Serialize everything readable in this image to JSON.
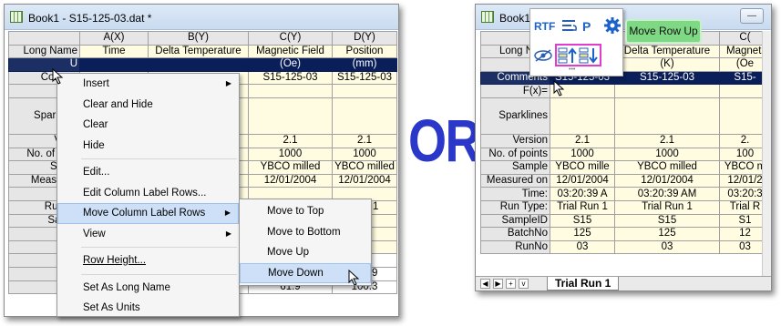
{
  "left": {
    "title": "Book1 - S15-125-03.dat *",
    "columns": [
      "",
      "A(X)",
      "B(Y)",
      "C(Y)",
      "D(Y)"
    ],
    "rows": [
      {
        "label": "Long Name",
        "cells": [
          "Time",
          "Delta Temperature",
          "Magnetic Field",
          "Position"
        ]
      },
      {
        "label": "U",
        "cells": [
          "",
          "",
          "(Oe)",
          "(mm)"
        ],
        "selected": true
      },
      {
        "label": "Comme",
        "cells": [
          "",
          "",
          "S15-125-03",
          "S15-125-03"
        ]
      },
      {
        "label": "F",
        "cells": [
          "",
          "",
          "",
          ""
        ]
      },
      {
        "label": "Sparkline",
        "cells": [
          "",
          "",
          "",
          ""
        ],
        "tall": true
      },
      {
        "label": "Versi",
        "cells": [
          "",
          "",
          "2.1",
          "2.1"
        ]
      },
      {
        "label": "No. of poin",
        "cells": [
          "",
          "",
          "1000",
          "1000"
        ]
      },
      {
        "label": "Samp",
        "cells": [
          "",
          "",
          "YBCO milled",
          "YBCO milled"
        ]
      },
      {
        "label": "Measured",
        "cells": [
          "",
          "",
          "12/01/2004",
          "12/01/2004"
        ]
      },
      {
        "label": "Ti",
        "cells": [
          "",
          "",
          "",
          ""
        ]
      },
      {
        "label": "Run Ty",
        "cells": [
          "",
          "",
          "",
          "Run 1"
        ]
      },
      {
        "label": "Sampl",
        "cells": [
          "",
          "",
          "",
          ""
        ]
      },
      {
        "label": "Batc",
        "cells": [
          "",
          "",
          "",
          ""
        ]
      },
      {
        "label": "Run",
        "cells": [
          "",
          "",
          "",
          ""
        ]
      },
      {
        "label": "",
        "cells": [
          "",
          "",
          "",
          "1.7"
        ]
      },
      {
        "label": "",
        "cells": [
          "",
          "",
          "61.3",
          "100.9"
        ]
      },
      {
        "label": "",
        "cells": [
          "",
          "",
          "61.9",
          "100.3"
        ]
      }
    ],
    "context_menu": [
      {
        "label": "Insert",
        "sub": true
      },
      {
        "label": "Clear and Hide"
      },
      {
        "label": "Clear"
      },
      {
        "label": "Hide"
      },
      {
        "sep": true
      },
      {
        "label": "Edit..."
      },
      {
        "label": "Edit Column Label Rows..."
      },
      {
        "label": "Move Column Label Rows",
        "sub": true,
        "highlight": true
      },
      {
        "label": "View",
        "sub": true
      },
      {
        "sep": true
      },
      {
        "label": "Row Height..."
      },
      {
        "sep": true
      },
      {
        "label": "Set As Long Name"
      },
      {
        "label": "Set As Units"
      }
    ],
    "submenu": [
      "Move to Top",
      "Move to Bottom",
      "Move Up",
      "Move Down"
    ]
  },
  "or_label": "OR",
  "right": {
    "title": "Book1",
    "columns": [
      "",
      "",
      "",
      "C("
    ],
    "rows": [
      {
        "label": "Long Nam",
        "cells": [
          "",
          "",
          ""
        ]
      },
      {
        "label": "U",
        "cells": [
          "",
          "(K)",
          "(Oe"
        ]
      },
      {
        "label": "Comments",
        "cells": [
          "S15-125-03",
          "S15-125-03",
          "S15-"
        ],
        "selected": true
      },
      {
        "label": "F(x)=",
        "cells": [
          "",
          "",
          ""
        ]
      },
      {
        "label": "Sparklines",
        "cells": [
          "",
          "",
          ""
        ],
        "tall": true
      },
      {
        "label": "Version",
        "cells": [
          "2.1",
          "2.1",
          "2."
        ]
      },
      {
        "label": "No. of points",
        "cells": [
          "1000",
          "1000",
          "100"
        ]
      },
      {
        "label": "Sample",
        "cells": [
          "YBCO mille",
          "YBCO milled",
          "YBCO m"
        ]
      },
      {
        "label": "Measured on",
        "cells": [
          "12/01/2004",
          "12/01/2004",
          "12/01/2"
        ]
      },
      {
        "label": "Time:",
        "cells": [
          "03:20:39 A",
          "03:20:39 AM",
          "03:20:3"
        ]
      },
      {
        "label": "Run Type:",
        "cells": [
          "Trial Run 1",
          "Trial Run 1",
          "Trial R"
        ]
      },
      {
        "label": "SampleID",
        "cells": [
          "S15",
          "S15",
          "S1"
        ]
      },
      {
        "label": "BatchNo",
        "cells": [
          "125",
          "125",
          "12"
        ]
      },
      {
        "label": "RunNo",
        "cells": [
          "03",
          "03",
          "03"
        ]
      }
    ],
    "header_partial": [
      "",
      "Delta Temperature",
      "Magneti"
    ],
    "tab_label": "Trial Run 1",
    "toolbar": {
      "rtf": "RTF",
      "p": "P",
      "dots": "•••"
    },
    "tooltip": "Move Row Up",
    "accent_pink": "#e23bd0",
    "accent_blue": "#1c62c9"
  }
}
